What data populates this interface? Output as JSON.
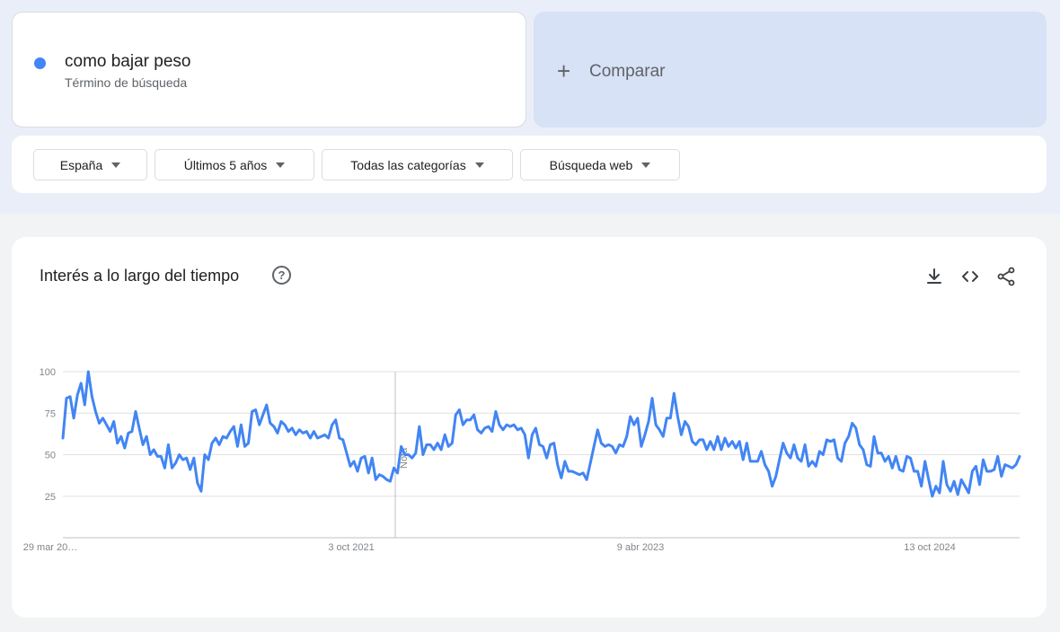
{
  "term": {
    "name": "como bajar peso",
    "type": "Término de búsqueda",
    "color": "#4285f4"
  },
  "compare": {
    "icon": "plus-icon",
    "label": "Comparar"
  },
  "filters": [
    {
      "label": "España"
    },
    {
      "label": "Últimos 5 años"
    },
    {
      "label": "Todas las categorías"
    },
    {
      "label": "Búsqueda web"
    }
  ],
  "chart_section": {
    "title": "Interés a lo largo del tiempo",
    "help_icon": "help-circle-icon",
    "actions": [
      "download-icon",
      "embed-code-icon",
      "share-icon"
    ]
  },
  "chart_data": {
    "type": "line",
    "title": "",
    "xlabel": "",
    "ylabel": "",
    "ylim": [
      0,
      100
    ],
    "y_ticks": [
      25,
      50,
      75,
      100
    ],
    "x_tick_labels": [
      "29 mar 20…",
      "3 oct 2021",
      "9 abr 2023",
      "13 oct 2024"
    ],
    "annotation": "Nota",
    "grid": true,
    "series": [
      {
        "color": "#4285f4",
        "values": [
          60,
          84,
          85,
          72,
          86,
          93,
          80,
          100,
          85,
          76,
          69,
          72,
          68,
          64,
          70,
          57,
          61,
          54,
          63,
          64,
          76,
          66,
          56,
          61,
          50,
          53,
          49,
          49,
          42,
          56,
          42,
          45,
          50,
          47,
          48,
          41,
          48,
          33,
          28,
          50,
          47,
          57,
          60,
          56,
          61,
          60,
          64,
          67,
          55,
          68,
          55,
          57,
          76,
          77,
          68,
          74,
          80,
          69,
          67,
          63,
          70,
          68,
          64,
          66,
          62,
          65,
          63,
          64,
          60,
          64,
          60,
          61,
          62,
          60,
          68,
          71,
          60,
          59,
          51,
          43,
          46,
          40,
          48,
          49,
          39,
          48,
          35,
          38,
          37,
          35,
          34,
          42,
          39,
          55,
          50,
          50,
          48,
          51,
          67,
          50,
          56,
          56,
          53,
          57,
          53,
          62,
          55,
          57,
          74,
          77,
          68,
          71,
          71,
          74,
          65,
          63,
          66,
          67,
          64,
          76,
          68,
          65,
          68,
          67,
          68,
          65,
          66,
          62,
          48,
          62,
          66,
          56,
          55,
          48,
          56,
          57,
          44,
          36,
          46,
          40,
          40,
          39,
          38,
          39,
          35,
          45,
          55,
          65,
          57,
          55,
          56,
          55,
          51,
          56,
          55,
          61,
          73,
          68,
          72,
          55,
          62,
          70,
          84,
          68,
          65,
          61,
          72,
          72,
          87,
          73,
          62,
          70,
          67,
          58,
          56,
          59,
          59,
          53,
          58,
          53,
          61,
          53,
          60,
          55,
          58,
          54,
          58,
          47,
          57,
          46,
          46,
          46,
          52,
          44,
          40,
          31,
          37,
          47,
          57,
          51,
          48,
          56,
          48,
          46,
          56,
          43,
          46,
          43,
          52,
          50,
          59,
          58,
          59,
          48,
          46,
          57,
          61,
          69,
          66,
          56,
          53,
          44,
          43,
          61,
          51,
          51,
          46,
          49,
          42,
          49,
          41,
          40,
          49,
          48,
          40,
          40,
          31,
          46,
          35,
          25,
          31,
          27,
          46,
          32,
          28,
          34,
          26,
          35,
          31,
          27,
          40,
          43,
          32,
          47,
          40,
          40,
          41,
          49,
          37,
          44,
          43,
          42,
          44,
          49
        ]
      }
    ]
  }
}
